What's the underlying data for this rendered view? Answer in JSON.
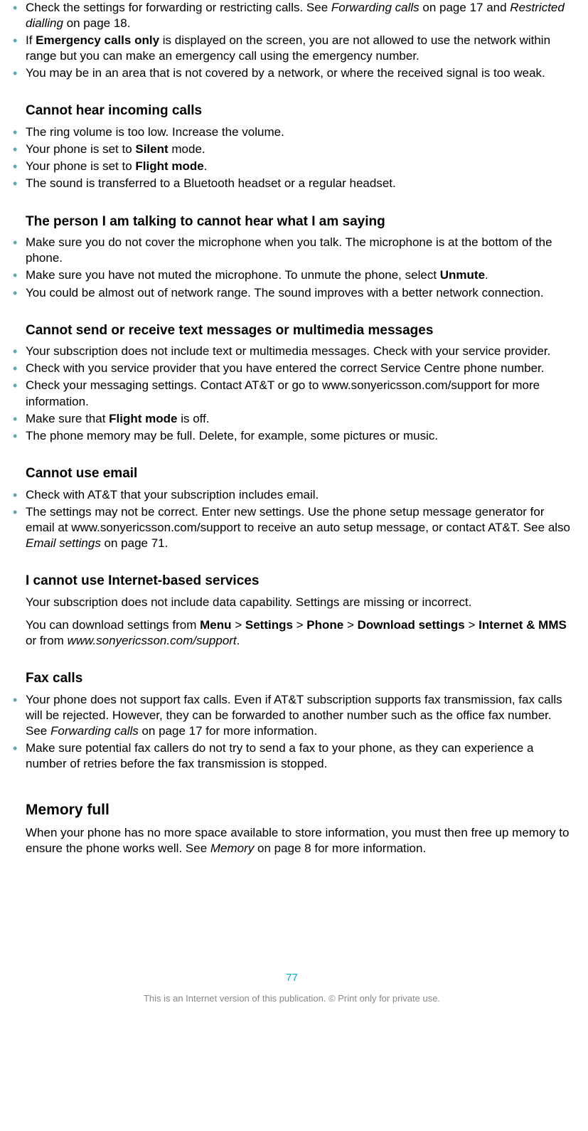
{
  "sections": {
    "top_list": [
      "Check the settings for forwarding or restricting calls. See <i>Forwarding calls</i> on page 17 and <i>Restricted dialling</i> on page 18.",
      "If <b>Emergency calls only</b> is displayed on the screen, you are not allowed to use the network within range but you can make an emergency call using the emergency number.",
      "You may be in an area that is not covered by a network, or where the received signal is too weak."
    ],
    "h1": "Cannot hear incoming calls",
    "list1": [
      "The ring volume is too low. Increase the volume.",
      "Your phone is set to <b>Silent</b> mode.",
      "Your phone is set to <b>Flight mode</b>.",
      "The sound is transferred to a Bluetooth headset or a regular headset."
    ],
    "h2": "The person I am talking to cannot hear what I am saying",
    "list2": [
      "Make sure you do not cover the microphone when you talk. The microphone is at the bottom of the phone.",
      "Make sure you have not muted the microphone. To unmute the phone, select <b>Unmute</b>.",
      "You could be almost out of network range. The sound improves with a better network connection."
    ],
    "h3": "Cannot send or receive text messages or multimedia messages",
    "list3": [
      "Your subscription does not include text or multimedia messages. Check with your service provider.",
      "Check with you service provider that you have entered the correct Service Centre phone number.",
      "Check your messaging settings. Contact AT&T or go to www.sonyericsson.com/support for more information.",
      "Make sure that <b>Flight mode</b> is off.",
      "The phone memory may be full. Delete, for example, some pictures or music."
    ],
    "h4": "Cannot use email",
    "list4": [
      "Check with AT&T that your subscription includes email.",
      "The settings may not be correct. Enter new settings. Use the phone setup message generator for email at www.sonyericsson.com/support to receive an auto setup message, or contact AT&T. See also <i>Email settings</i> on page 71."
    ],
    "h5": "I cannot use Internet-based services",
    "p5a": "Your subscription does not include data capability. Settings are missing or incorrect.",
    "p5b": "You can download settings from <b>Menu</b> > <b>Settings</b> > <b>Phone</b> > <b>Download settings</b> > <b>Internet & MMS</b> or from <i>www.sonyericsson.com/support</i>.",
    "h6": "Fax calls",
    "list6": [
      "Your phone does not support fax calls. Even if AT&T subscription supports fax transmission, fax calls will be rejected. However, they can be forwarded to another number such as the office fax number. See <i>Forwarding calls</i> on page 17 for more information.",
      "Make sure potential fax callers do not try to send a fax to your phone, as they can experience a number of retries before the fax transmission is stopped."
    ],
    "h7": "Memory full",
    "p7": "When your phone has no more space available to store information, you must then free up memory to ensure the phone works well. See <i>Memory</i> on page 8 for more information."
  },
  "page_number": "77",
  "footer": "This is an Internet version of this publication. © Print only for private use."
}
